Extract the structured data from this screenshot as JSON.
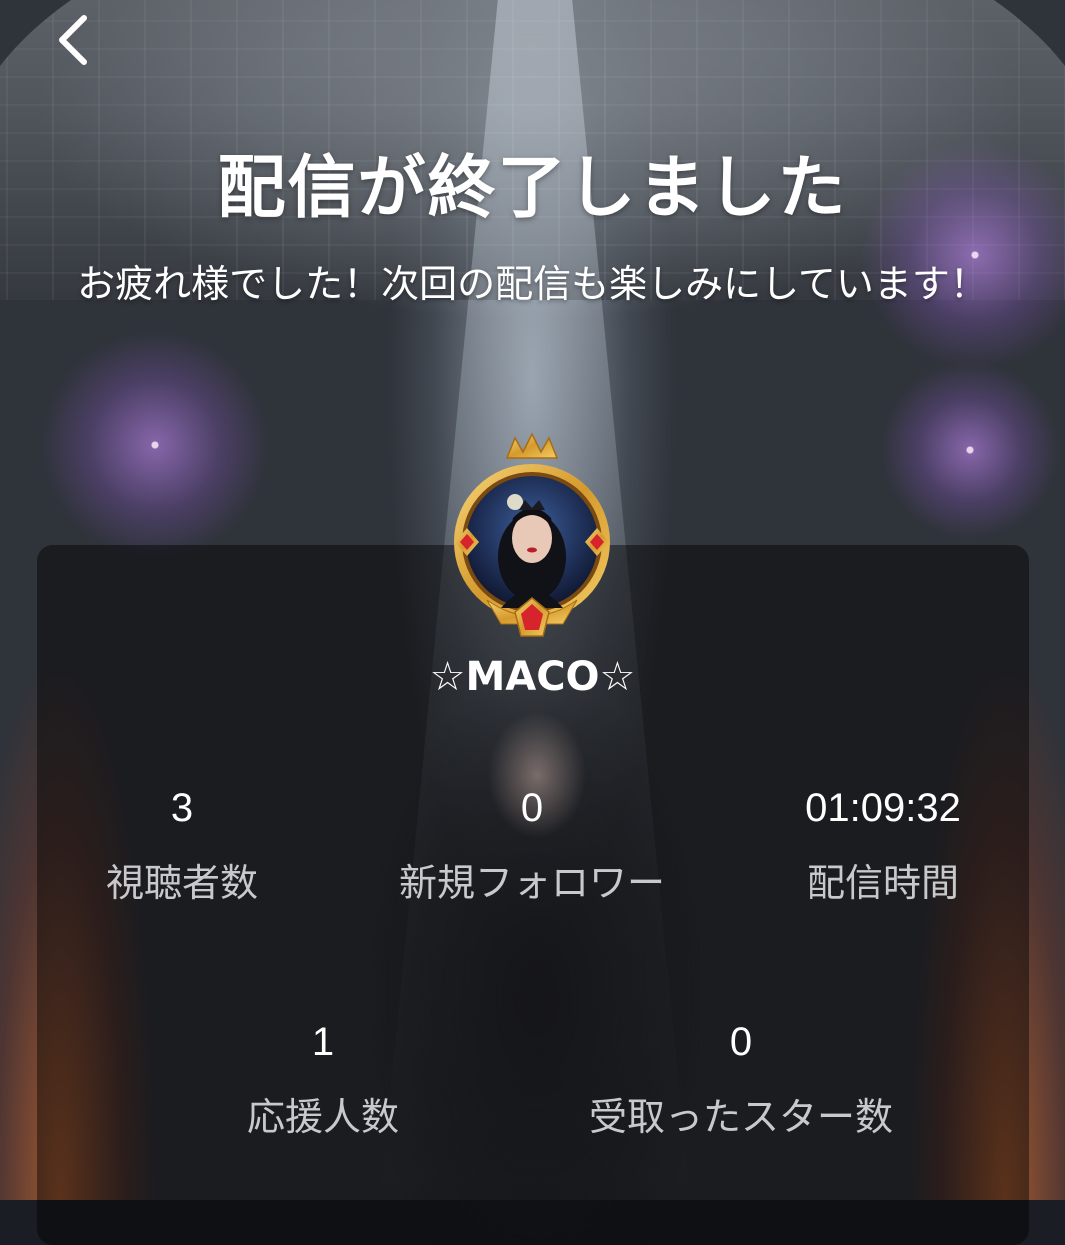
{
  "header": {
    "back_icon": "chevron-left-icon"
  },
  "title": "配信が終了しました",
  "subtitle": "お疲れ様でした！次回の配信も楽しみにしています！",
  "profile": {
    "username": "☆MACO☆",
    "frame_color": "#e0a63a"
  },
  "stats": {
    "viewers": {
      "value": "3",
      "label": "視聴者数"
    },
    "new_followers": {
      "value": "0",
      "label": "新規フォロワー"
    },
    "stream_time": {
      "value": "01:09:32",
      "label": "配信時間"
    },
    "supporters": {
      "value": "1",
      "label": "応援人数"
    },
    "stars_received": {
      "value": "0",
      "label": "受取ったスター数"
    }
  }
}
